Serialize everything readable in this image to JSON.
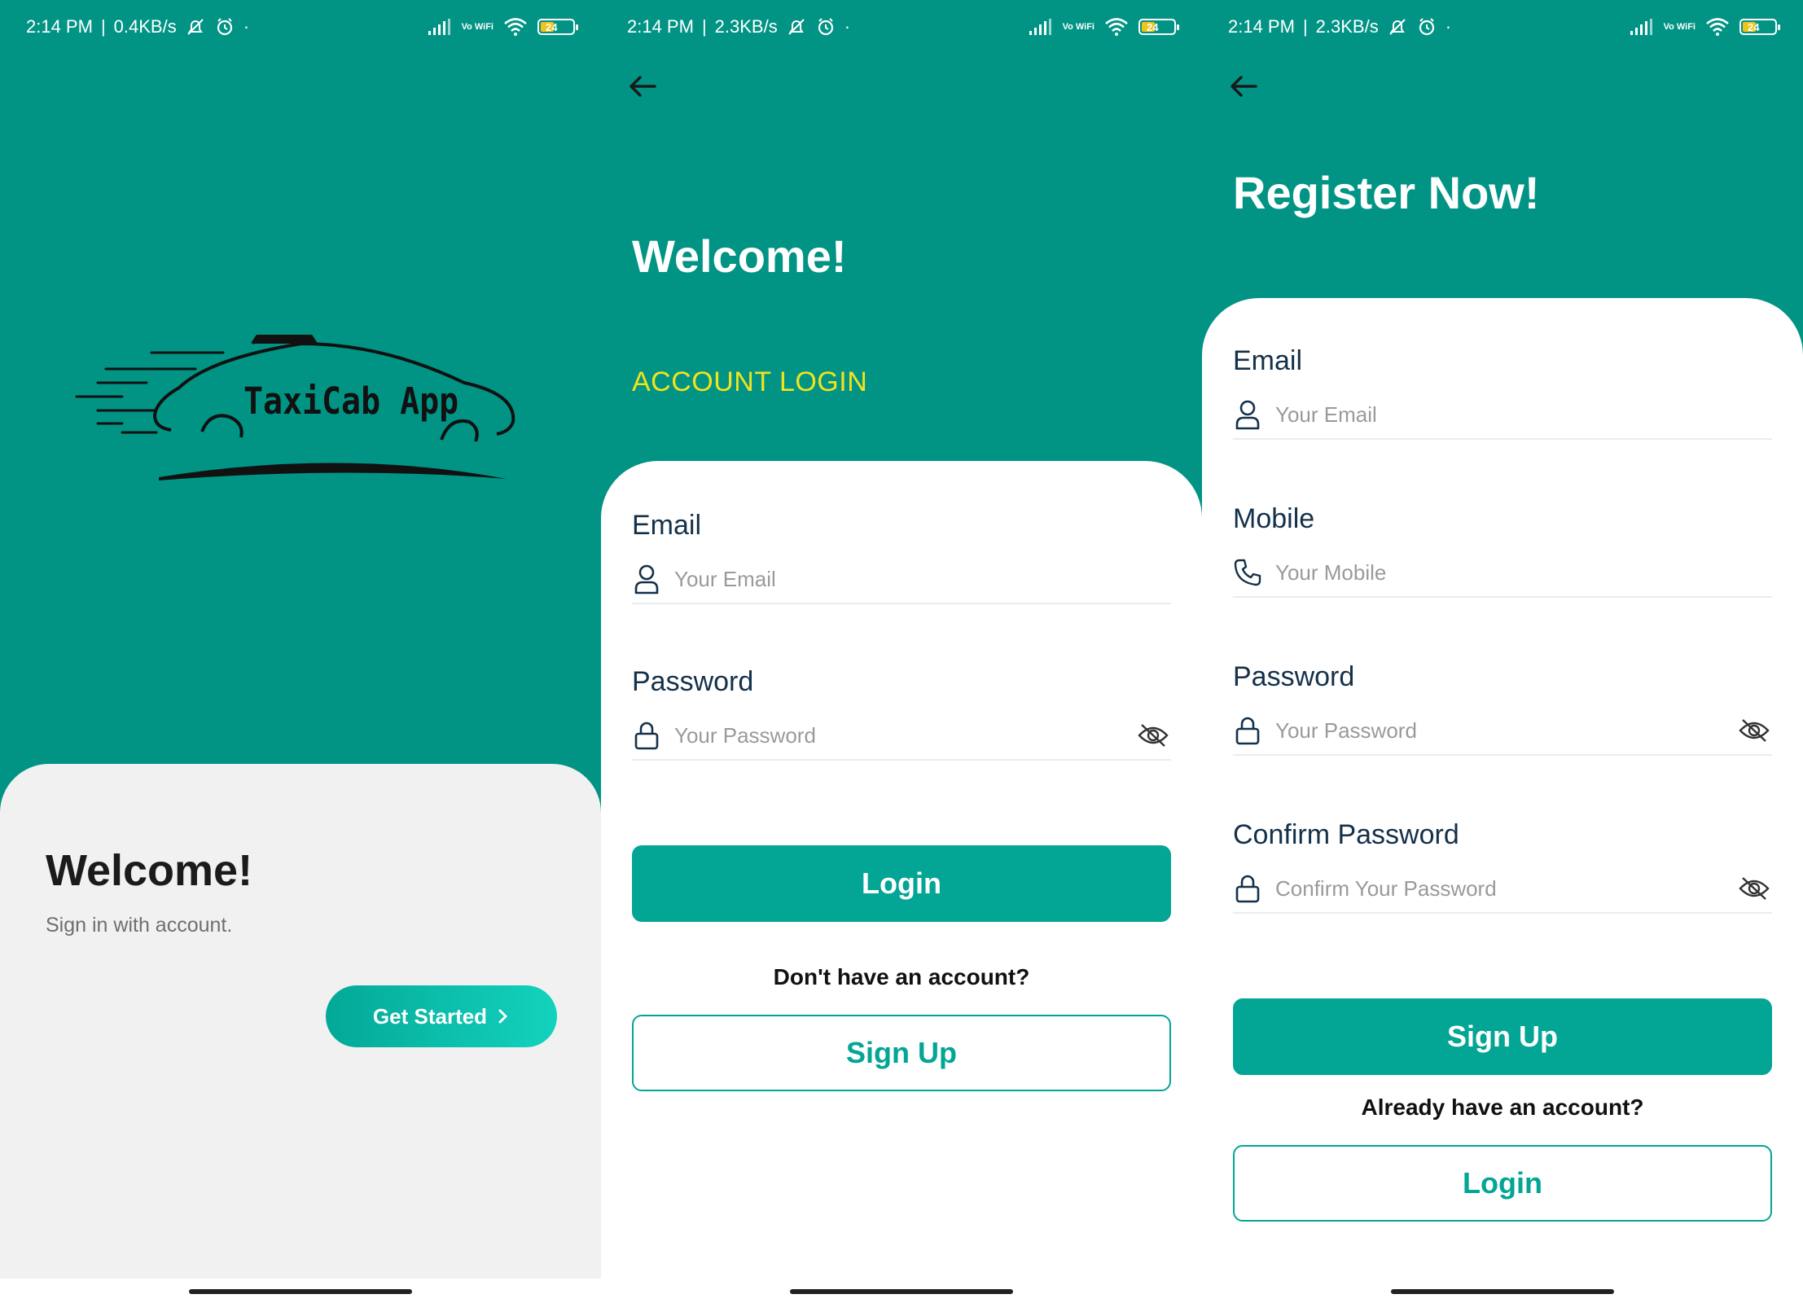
{
  "colors": {
    "teal": "#019485",
    "button": "#03a595",
    "accent_yellow": "#f2e31b",
    "sheet": "#f1f1f1"
  },
  "screens": [
    {
      "status": {
        "time": "2:14 PM",
        "speed": "0.4KB/s",
        "vowifi": "Vo WiFi",
        "battery": "24"
      },
      "logo_text": "TaxiCab App",
      "title": "Welcome!",
      "subtitle": "Sign in with account.",
      "get_started": "Get Started"
    },
    {
      "status": {
        "time": "2:14 PM",
        "speed": "2.3KB/s",
        "vowifi": "Vo WiFi",
        "battery": "24"
      },
      "title": "Welcome!",
      "subtitle": "ACCOUNT LOGIN",
      "email_label": "Email",
      "email_placeholder": "Your Email",
      "password_label": "Password",
      "password_placeholder": "Your Password",
      "login_button": "Login",
      "no_account_prompt": "Don't have an account?",
      "signup_button": "Sign Up"
    },
    {
      "status": {
        "time": "2:14 PM",
        "speed": "2.3KB/s",
        "vowifi": "Vo WiFi",
        "battery": "24"
      },
      "title": "Register Now!",
      "email_label": "Email",
      "email_placeholder": "Your Email",
      "mobile_label": "Mobile",
      "mobile_placeholder": "Your Mobile",
      "password_label": "Password",
      "password_placeholder": "Your Password",
      "confirm_label": "Confirm Password",
      "confirm_placeholder": "Confirm Your Password",
      "signup_button": "Sign Up",
      "have_account_prompt": "Already have an account?",
      "login_button": "Login"
    }
  ]
}
